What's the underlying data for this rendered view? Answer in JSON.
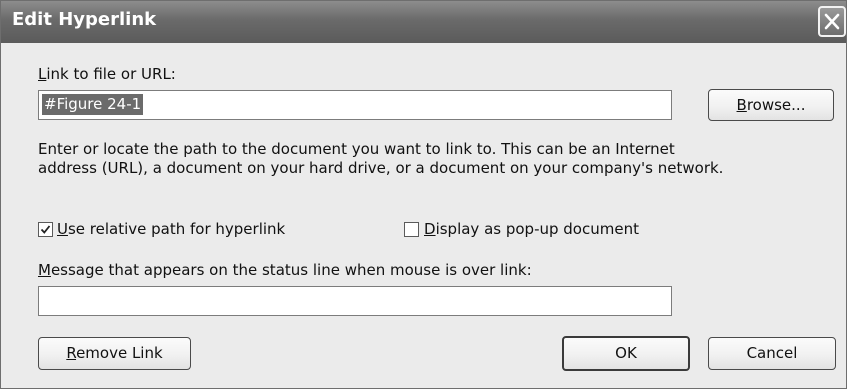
{
  "window": {
    "title": "Edit Hyperlink",
    "close_icon": "close-x-icon"
  },
  "link": {
    "label_accesskey": "L",
    "label_rest": "ink to file or URL:",
    "value": "#Figure 24-1",
    "browse_label": "Browse...",
    "browse_accesskey": "B",
    "browse_rest": "rowse..."
  },
  "description": {
    "line1": "Enter or locate the path to the document you want to link to. This can be an Internet",
    "line2": "address (URL), a document on your hard drive, or a document on your company's network."
  },
  "options": {
    "relative_path": {
      "checked": true,
      "accesskey": "U",
      "rest": "se relative path for hyperlink"
    },
    "popup": {
      "checked": false,
      "accesskey": "D",
      "rest": "isplay as pop-up document"
    }
  },
  "status": {
    "label_accesskey": "M",
    "label_rest": "essage that appears on the status line when mouse is over link:",
    "value": ""
  },
  "buttons": {
    "remove_accesskey": "R",
    "remove_rest": "emove Link",
    "ok": "OK",
    "cancel": "Cancel"
  }
}
